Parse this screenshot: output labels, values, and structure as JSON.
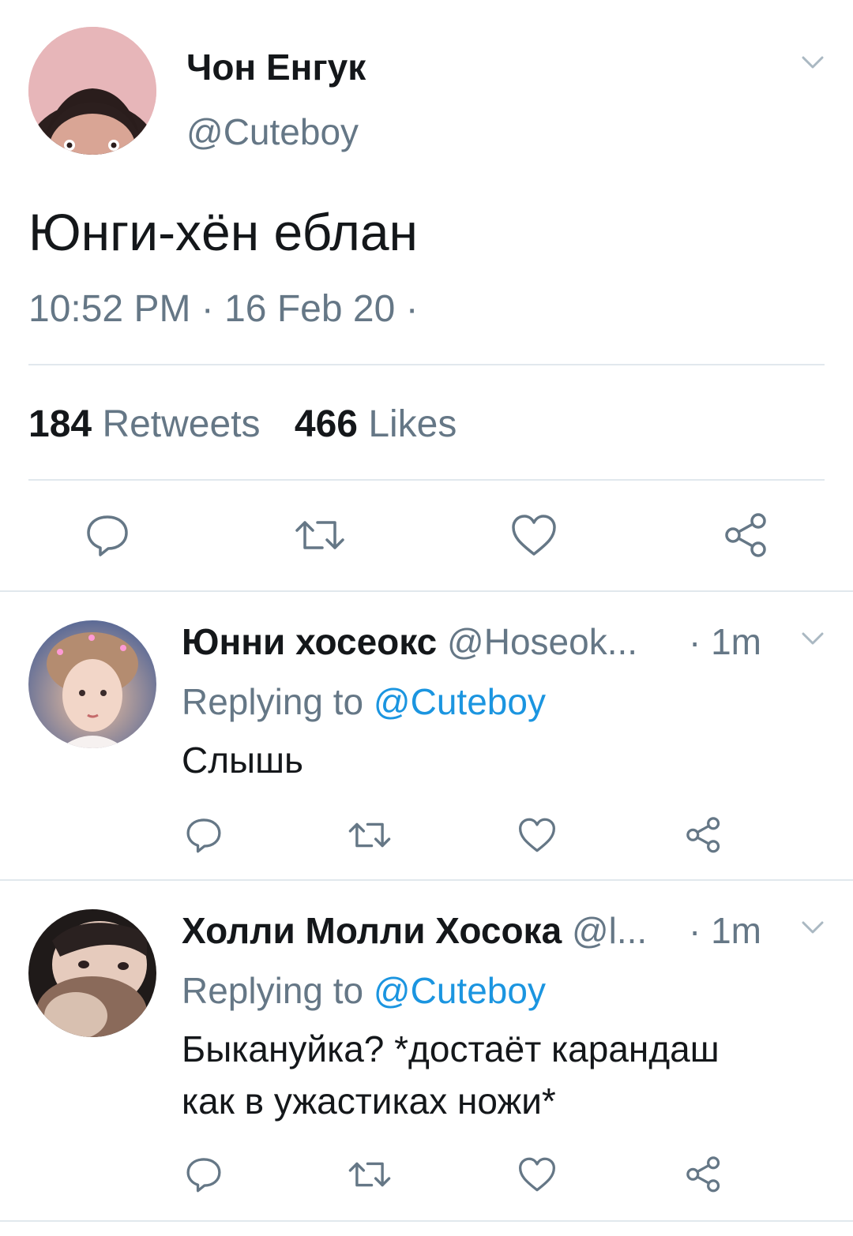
{
  "main_tweet": {
    "author_name": "Чон Енгук",
    "handle": "@Cuteboy",
    "text": "Юнги-хён еблан",
    "timestamp": "10:52 PM · 16 Feb 20 ·",
    "stats": {
      "retweets_count": "184",
      "retweets_label": "Retweets",
      "likes_count": "466",
      "likes_label": "Likes"
    },
    "avatar_icon": "user-photo"
  },
  "replies": [
    {
      "author_name": "Юнни хосеокс",
      "handle": "@Hoseok...",
      "time": "· 1m",
      "replying_prefix": "Replying to",
      "replying_handle": "@Cuteboy",
      "text": "Слышь",
      "avatar_icon": "user-photo"
    },
    {
      "author_name": "Холли Молли Хосока",
      "handle": "@l...",
      "time": "· 1m",
      "replying_prefix": "Replying to",
      "replying_handle": "@Cuteboy",
      "text_line1": "Быкануйка? *достаёт карандаш",
      "text_line2": "как в ужастиках ножи*",
      "avatar_icon": "user-photo"
    }
  ],
  "icons": {
    "reply": "reply-icon",
    "retweet": "retweet-icon",
    "like": "heart-icon",
    "share": "share-icon",
    "menu": "chevron-down-icon"
  },
  "colors": {
    "text": "#14171a",
    "secondary": "#657786",
    "link": "#1b95e0",
    "divider": "#e1e8ed"
  }
}
